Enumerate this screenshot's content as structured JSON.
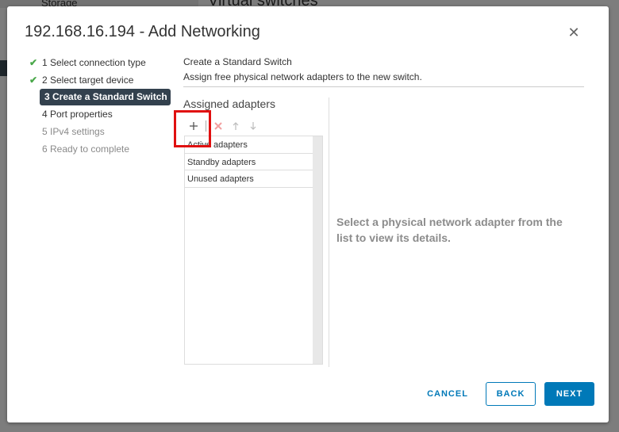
{
  "background": {
    "storage_label": "Storage",
    "page_heading": "Virtual switches"
  },
  "dialog": {
    "title": "192.168.16.194 - Add Networking",
    "close_icon": "close-icon"
  },
  "steps": [
    {
      "label": "1 Select connection type",
      "status": "done"
    },
    {
      "label": "2 Select target device",
      "status": "done"
    },
    {
      "label": "3 Create a Standard Switch",
      "status": "current"
    },
    {
      "label": "4 Port properties",
      "status": "upcoming"
    },
    {
      "label": "5 IPv4 settings",
      "status": "upcoming"
    },
    {
      "label": "6 Ready to complete",
      "status": "upcoming"
    }
  ],
  "content": {
    "title": "Create a Standard Switch",
    "subtitle": "Assign free physical network adapters to the new switch.",
    "assigned_title": "Assigned adapters",
    "toolbar": [
      "add-icon",
      "remove-icon",
      "arrow-up-icon",
      "arrow-down-icon"
    ],
    "adapter_groups": [
      "Active adapters",
      "Standby adapters",
      "Unused adapters"
    ],
    "details_message": "Select a physical network adapter from the list to view its details."
  },
  "footer": {
    "cancel": "CANCEL",
    "back": "BACK",
    "next": "NEXT"
  },
  "colors": {
    "accent": "#0079b8",
    "current_step_bg": "#33414e",
    "check": "#4aa84a",
    "highlight": "#e01010"
  }
}
